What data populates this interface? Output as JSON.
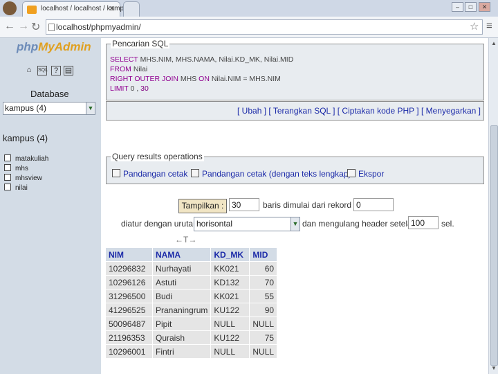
{
  "browser": {
    "tab_title": "localhost / localhost / kampus",
    "url": "localhost/phpmyadmin/",
    "win_min": "–",
    "win_max": "□",
    "win_close": "✕"
  },
  "sidebar": {
    "logo": "phpMyAdmin",
    "database_label": "Database",
    "database_selected": "kampus (4)",
    "db_title": "kampus (4)",
    "tables": [
      "matakuliah",
      "mhs",
      "mhsview",
      "nilai"
    ]
  },
  "sql_panel": {
    "legend": "Pencarian SQL",
    "line1": [
      "SELECT",
      " MHS.NIM, MHS.NAMA, Nilai.KD_MK, Nilai.MID"
    ],
    "line2": [
      "FROM",
      " Nilai"
    ],
    "line3": [
      "RIGHT OUTER JOIN",
      " MHS ",
      "ON",
      " Nilai.NIM = MHS.NIM"
    ],
    "line4": [
      "LIMIT",
      " 0 , ",
      "30"
    ],
    "links": "[ Ubah ] [ Terangkan SQL ] [ Ciptakan kode PHP ] [ Menyegarkan ]"
  },
  "query_ops": {
    "legend": "Query results operations",
    "items": [
      "Pandangan cetak",
      "Pandangan cetak (dengan teks lengkap)",
      "Ekspor"
    ]
  },
  "navigation": {
    "show_button": "Tampilkan :",
    "rows_value": "30",
    "rows_text": "baris dimulai dari rekord #",
    "start_value": "0",
    "orient_prefix": "diatur dengan urutan",
    "orient_value": "horisontal",
    "repeat_text": "dan mengulang header setelah",
    "repeat_value": "100",
    "repeat_suffix": "sel."
  },
  "results": {
    "arrows": "←T→",
    "columns": [
      "NIM",
      "NAMA",
      "KD_MK",
      "MID"
    ],
    "rows": [
      [
        "10296832",
        "Nurhayati",
        "KK021",
        "60"
      ],
      [
        "10296126",
        "Astuti",
        "KD132",
        "70"
      ],
      [
        "31296500",
        "Budi",
        "KK021",
        "55"
      ],
      [
        "41296525",
        "Prananingrum",
        "KU122",
        "90"
      ],
      [
        "50096487",
        "Pipit",
        "NULL",
        "NULL"
      ],
      [
        "21196353",
        "Quraish",
        "KU122",
        "75"
      ],
      [
        "10296001",
        "Fintri",
        "NULL",
        "NULL"
      ]
    ]
  },
  "colors": {
    "sidebar_bg": "#d3dce6",
    "panel_bg": "#e8ecf0",
    "link": "#1b2aa8",
    "keyword": "#900090"
  }
}
